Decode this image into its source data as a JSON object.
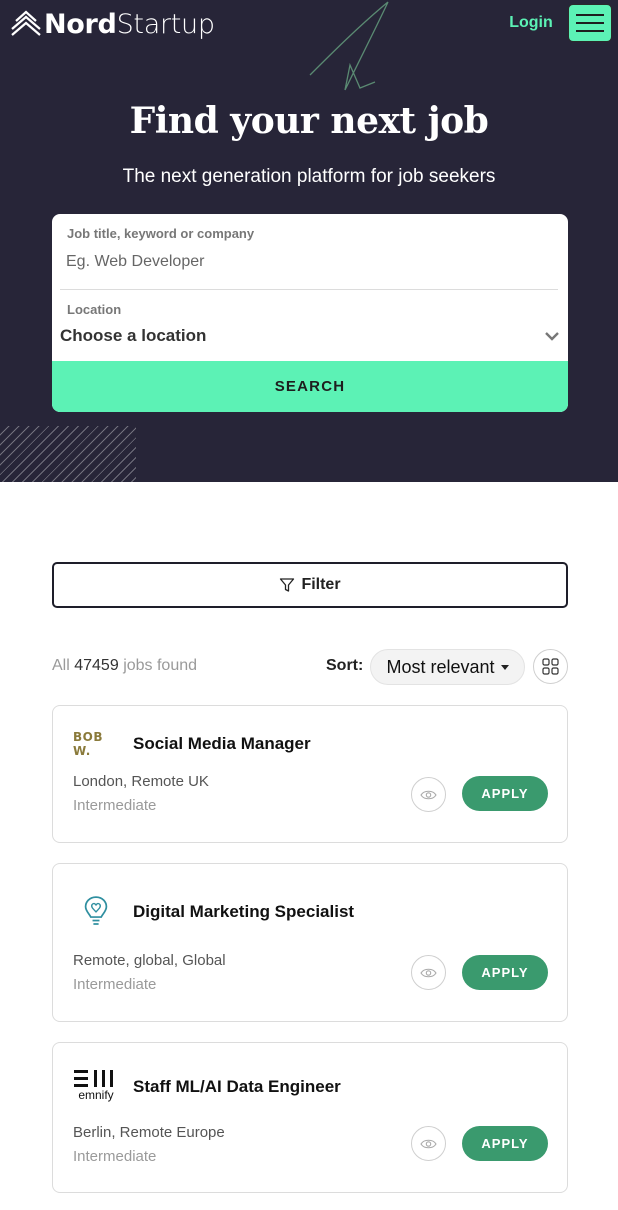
{
  "header": {
    "logo_bold": "Nord",
    "logo_light": "Startup",
    "login_label": "Login",
    "menu_icon": "hamburger-menu-icon"
  },
  "hero": {
    "title": "Find your next job",
    "subtitle": "The next generation platform for job seekers"
  },
  "search": {
    "keyword_label": "Job title, keyword or company",
    "keyword_placeholder": "Eg. Web Developer",
    "keyword_value": "",
    "location_label": "Location",
    "location_value": "Choose a location",
    "button_label": "SEARCH"
  },
  "filter": {
    "label": "Filter",
    "icon": "funnel-icon"
  },
  "results": {
    "prefix": "All",
    "count": "47459",
    "suffix": "jobs found",
    "sort_label": "Sort:",
    "sort_value": "Most relevant",
    "view_icon": "grid-view-icon"
  },
  "jobs": [
    {
      "company_logo": "BOB W.",
      "title": "Social Media Manager",
      "location": "London, Remote UK",
      "level": "Intermediate",
      "apply_label": "APPLY"
    },
    {
      "company_logo": "lightbulb-heart-logo",
      "title": "Digital Marketing Specialist",
      "location": "Remote, global, Global",
      "level": "Intermediate",
      "apply_label": "APPLY"
    },
    {
      "company_logo": "emnify",
      "title": "Staff ML/AI Data Engineer",
      "location": "Berlin, Remote Europe",
      "level": "Intermediate",
      "apply_label": "APPLY"
    }
  ],
  "colors": {
    "hero_bg": "#272538",
    "accent": "#5cf2b5",
    "apply": "#3a9a6e"
  }
}
